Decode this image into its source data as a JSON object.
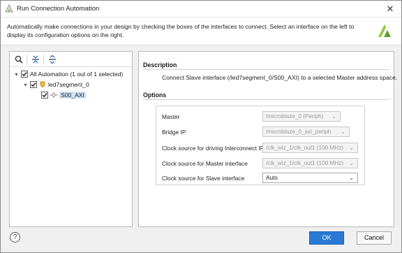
{
  "window": {
    "title": "Run Connection Automation",
    "close_glyph": "✕",
    "title_icon": "xilinx-vivado-icon"
  },
  "banner": {
    "text": "Automatically make connections in your design by checking the boxes of the interfaces to connect. Select an interface on the left to display its configuration options on the right.",
    "logo_icon": "xilinx-logo-icon"
  },
  "toolbar": {
    "icons": [
      "search-icon",
      "collapse-all-icon",
      "expand-all-icon"
    ]
  },
  "tree": {
    "root": {
      "label": "All Automation (1 out of 1 selected)",
      "checked": true,
      "expander": "▾"
    },
    "ip": {
      "label": "led7segment_0",
      "checked": true,
      "expander": "▾"
    },
    "interface": {
      "label": "S00_AXI",
      "checked": true
    }
  },
  "description": {
    "heading": "Description",
    "text": "Connect Slave interface (/led7segment_0/S00_AXI) to a selected Master address space."
  },
  "options": {
    "heading": "Options",
    "rows": [
      {
        "label": "Master",
        "value": "/microblaze_0 (Periph)",
        "enabled": false
      },
      {
        "label": "Bridge IP",
        "value": "/microblaze_0_axi_periph",
        "enabled": false
      },
      {
        "label": "Clock source for driving Interconnect IP",
        "value": "/clk_wiz_1/clk_out1 (100 MHz)",
        "enabled": false
      },
      {
        "label": "Clock source for Master interface",
        "value": "/clk_wiz_1/clk_out1 (100 MHz)",
        "enabled": false
      },
      {
        "label": "Clock source for Slave interface",
        "value": "Auto",
        "enabled": true
      }
    ],
    "dropdown_glyph": "⌄"
  },
  "footer": {
    "help_glyph": "?",
    "ok_label": "OK",
    "cancel_label": "Cancel"
  },
  "colors": {
    "primary_button": "#2a7ad5",
    "selection": "#cfe4f7",
    "xilinx_logo": "#8dc63f"
  }
}
